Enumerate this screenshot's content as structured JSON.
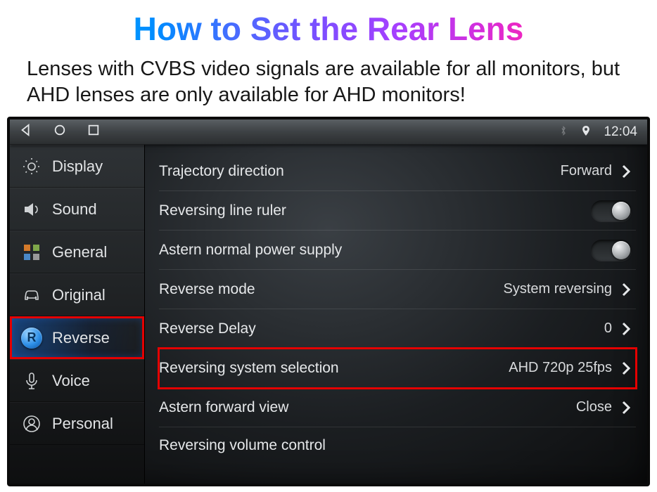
{
  "headline": "How to Set the Rear Lens",
  "subline": "Lenses with CVBS video signals are available for all monitors, but AHD lenses are only available for AHD monitors!",
  "statusbar": {
    "time": "12:04"
  },
  "sidebar": {
    "items": [
      {
        "label": "Display",
        "icon": "brightness-icon"
      },
      {
        "label": "Sound",
        "icon": "speaker-icon"
      },
      {
        "label": "General",
        "icon": "grid-icon"
      },
      {
        "label": "Original",
        "icon": "car-icon"
      },
      {
        "label": "Reverse",
        "icon": "reverse-badge-icon",
        "active": true,
        "highlight": true
      },
      {
        "label": "Voice",
        "icon": "microphone-icon"
      },
      {
        "label": "Personal",
        "icon": "person-icon"
      }
    ]
  },
  "settings": {
    "rows": [
      {
        "label": "Trajectory direction",
        "value": "Forward",
        "control": "chevron"
      },
      {
        "label": "Reversing line ruler",
        "value": "",
        "control": "toggle-off"
      },
      {
        "label": "Astern normal power supply",
        "value": "",
        "control": "toggle-off"
      },
      {
        "label": "Reverse mode",
        "value": "System reversing",
        "control": "chevron"
      },
      {
        "label": "Reverse Delay",
        "value": "0",
        "control": "chevron"
      },
      {
        "label": "Reversing system selection",
        "value": "AHD 720p 25fps",
        "control": "chevron",
        "highlight": true
      },
      {
        "label": "Astern forward view",
        "value": "Close",
        "control": "chevron"
      }
    ],
    "cutoff_row_label": "Reversing volume control"
  }
}
